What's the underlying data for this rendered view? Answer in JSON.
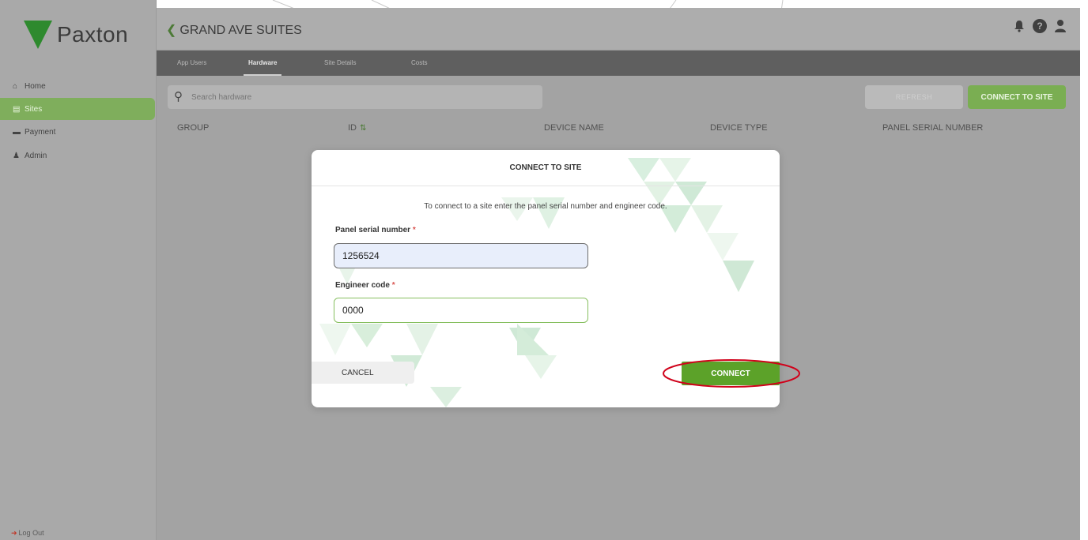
{
  "brand": {
    "name": "Paxton",
    "logo_color": "#2e8a2e"
  },
  "sidebar": {
    "items": [
      {
        "label": "Home",
        "icon": "home-icon"
      },
      {
        "label": "Sites",
        "icon": "sites-icon",
        "active": true
      },
      {
        "label": "Payment",
        "icon": "card-icon"
      },
      {
        "label": "Admin",
        "icon": "user-icon"
      }
    ],
    "logout": "Log Out"
  },
  "header": {
    "back_label": "GRAND AVE SUITES",
    "icons": [
      "bell-icon",
      "help-icon",
      "user-icon"
    ]
  },
  "tabs": [
    {
      "label": "App Users"
    },
    {
      "label": "Hardware",
      "active": true
    },
    {
      "label": "Site Details"
    },
    {
      "label": "Costs"
    }
  ],
  "toolbar": {
    "search_placeholder": "Search hardware",
    "refresh_label": "REFRESH",
    "connect_site_label": "CONNECT TO SITE"
  },
  "table": {
    "columns": [
      "GROUP",
      "ID",
      "DEVICE NAME",
      "DEVICE TYPE",
      "PANEL SERIAL NUMBER"
    ]
  },
  "modal": {
    "title": "CONNECT TO SITE",
    "description": "To connect to a site enter the panel serial number and engineer code.",
    "serial_label": "Panel serial number",
    "serial_value": "1256524",
    "code_label": "Engineer code",
    "code_value": "0000",
    "required_mark": "*",
    "cancel_label": "CANCEL",
    "connect_label": "CONNECT"
  },
  "colors": {
    "accent_green": "#5ca229",
    "highlight_red": "#d0021b"
  }
}
